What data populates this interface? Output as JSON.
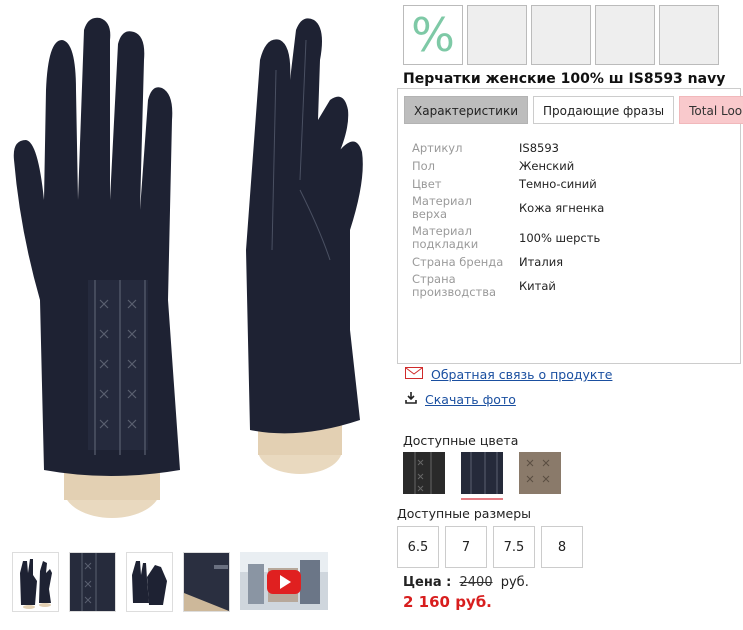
{
  "product": {
    "title": "Перчатки женские 100% ш IS8593 navy",
    "sale_badge": "%"
  },
  "tabs": [
    {
      "label": "Характеристики"
    },
    {
      "label": "Продающие фразы"
    },
    {
      "label": "Total Looks"
    }
  ],
  "specs": [
    {
      "label": "Артикул",
      "value": "IS8593"
    },
    {
      "label": "Пол",
      "value": "Женский"
    },
    {
      "label": "Цвет",
      "value": "Темно-синий"
    },
    {
      "label": "Материал верха",
      "value": "Кожа ягненка"
    },
    {
      "label": "Материал подкладки",
      "value": "100% шерсть"
    },
    {
      "label": "Страна бренда",
      "value": "Италия"
    },
    {
      "label": "Страна производства",
      "value": "Китай"
    }
  ],
  "links": {
    "feedback": "Обратная связь о продукте",
    "download": "Скачать фото"
  },
  "colors": {
    "label": "Доступные цвета",
    "items": [
      {
        "name": "black",
        "hex": "#2a2a2a"
      },
      {
        "name": "navy",
        "hex": "#252a3a"
      },
      {
        "name": "taupe",
        "hex": "#8a7a6a"
      }
    ],
    "selected_index": 1
  },
  "sizes": {
    "label": "Доступные размеры",
    "items": [
      "6.5",
      "7",
      "7.5",
      "8"
    ]
  },
  "price": {
    "label": "Цена :",
    "old": "2400",
    "currency_old": "руб.",
    "new": "2 160 руб."
  },
  "colors_palette": {
    "glove": "#1e2233",
    "accent_red": "#d81e1e",
    "link_blue": "#1a4fa0",
    "tab_pink": "#f9c9cc"
  }
}
